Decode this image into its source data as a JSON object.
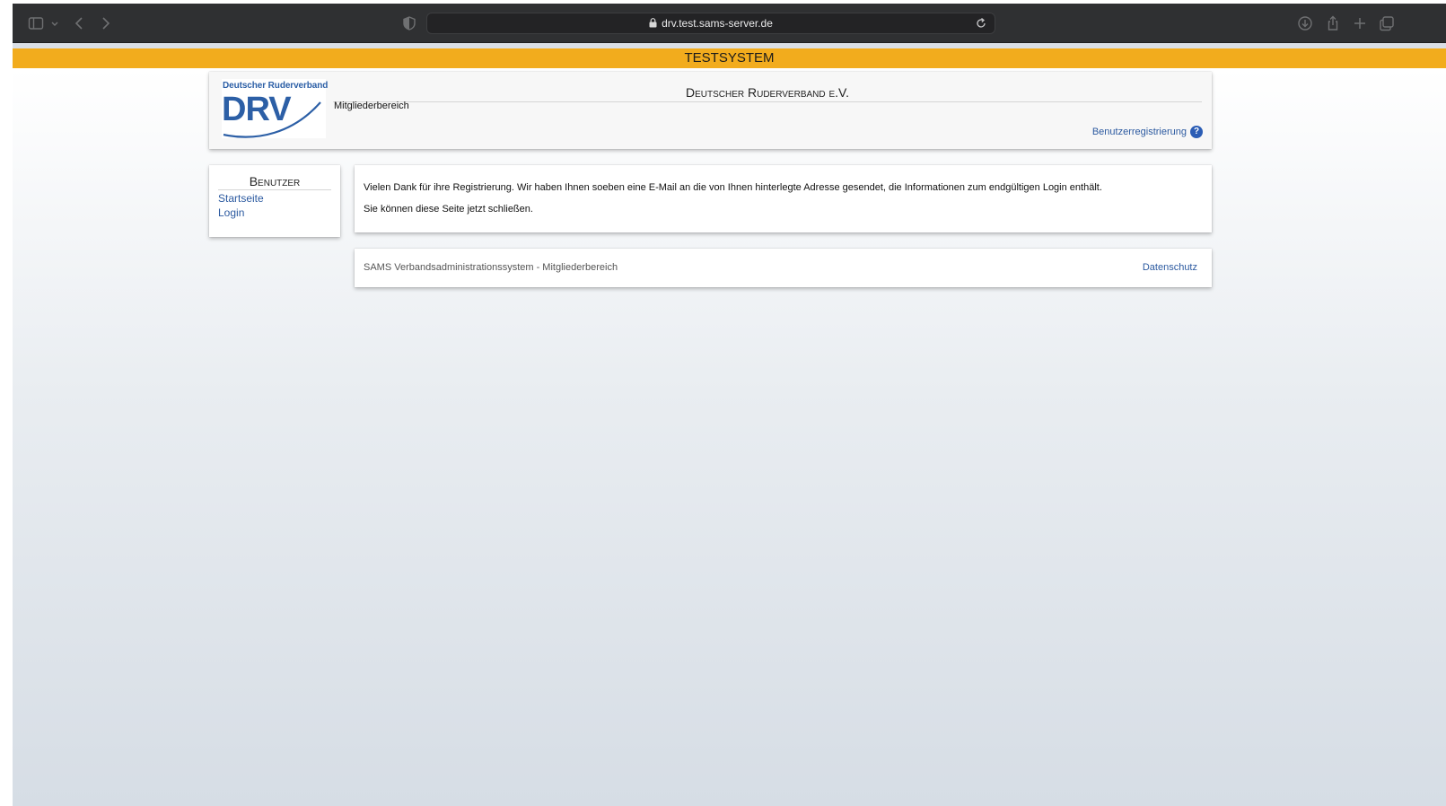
{
  "browser": {
    "url": "drv.test.sams-server.de",
    "icons": [
      "sidebar-icon",
      "chevron-down-icon",
      "back-icon",
      "forward-icon",
      "shield-icon",
      "lock-icon",
      "reload-icon",
      "download-icon",
      "share-icon",
      "plus-icon",
      "tabs-icon"
    ]
  },
  "banner": {
    "label": "TESTSYSTEM",
    "color": "#f2ac1d"
  },
  "header": {
    "logo_subtitle": "Deutscher Ruderverband",
    "logo_text": "DRV",
    "org_title": "Deutscher Ruderverband e.V.",
    "area_label": "Mitgliederbereich",
    "register_link": "Benutzerregistrierung",
    "help_symbol": "?"
  },
  "sidebar": {
    "title": "Benutzer",
    "items": [
      {
        "label": "Startseite"
      },
      {
        "label": "Login"
      }
    ]
  },
  "message": {
    "line1": "Vielen Dank für ihre Registrierung. Wir haben Ihnen soeben eine E-Mail an die von Ihnen hinterlegte Adresse gesendet, die Informationen zum endgültigen Login enthält.",
    "line2": "Sie können diese Seite jetzt schließen."
  },
  "footer": {
    "text": "SAMS Verbandsadministrationssystem - Mitgliederbereich",
    "privacy_link": "Datenschutz"
  },
  "colors": {
    "link": "#2c5aa0",
    "brand": "#2c5fa6",
    "toolbar": "#2f3032"
  }
}
